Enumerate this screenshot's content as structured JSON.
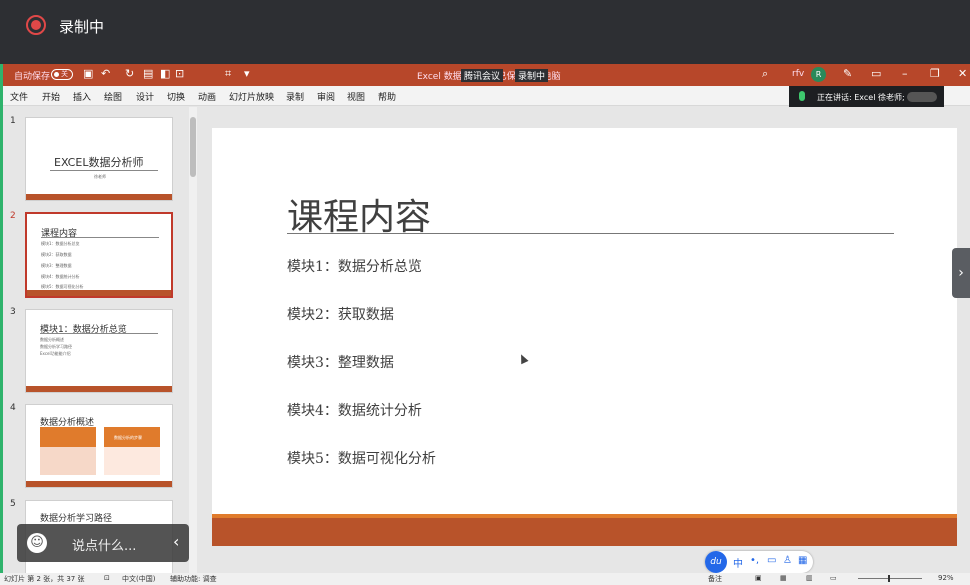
{
  "recording": {
    "label": "录制中"
  },
  "titlebar": {
    "autosave": "自动保存",
    "autosave_state": "关",
    "doc_title": "Excel 数据分析师 - 已保存到此电脑",
    "meeting": "腾讯会议",
    "recording_badge": "录制中",
    "user_initials": "rfv",
    "avatar_letter": "R"
  },
  "menu": {
    "items": [
      "文件",
      "开始",
      "插入",
      "绘图",
      "设计",
      "切换",
      "动画",
      "幻灯片放映",
      "录制",
      "审阅",
      "视图",
      "帮助"
    ]
  },
  "speaking": {
    "label": "正在讲话: Excel 徐老师;"
  },
  "thumbnails": [
    {
      "num": "1",
      "title": "EXCEL数据分析师",
      "sub": "徐老师"
    },
    {
      "num": "2",
      "title": "课程内容",
      "lines": [
        "模块1：数据分析总览",
        "模块2：获取数据",
        "模块3：整理数据",
        "模块4：数据统计分析",
        "模块5：数据可视化分析"
      ]
    },
    {
      "num": "3",
      "title": "模块1：数据分析总览",
      "lines": [
        "数据分析概述",
        "数据分析学习路径",
        "Excel功能能介绍"
      ]
    },
    {
      "num": "4",
      "title": "数据分析概述",
      "box_title": "数据分析的步骤"
    },
    {
      "num": "5",
      "title": "数据分析学习路径"
    }
  ],
  "slide": {
    "title": "课程内容",
    "modules": [
      "模块1：数据分析总览",
      "模块2：获取数据",
      "模块3：整理数据",
      "模块4：数据统计分析",
      "模块5：数据可视化分析"
    ]
  },
  "chat": {
    "placeholder": "说点什么..."
  },
  "ime": {
    "du": "du",
    "lang": "中"
  },
  "status": {
    "slide_info": "幻灯片 第 2 张，共 37 张",
    "language": "中文(中国)",
    "accessibility": "辅助功能: 调查",
    "notes": "备注",
    "zoom": "92%"
  },
  "colors": {
    "accent": "#b7472a",
    "band": "#b8532a",
    "rec": "#e04848"
  }
}
